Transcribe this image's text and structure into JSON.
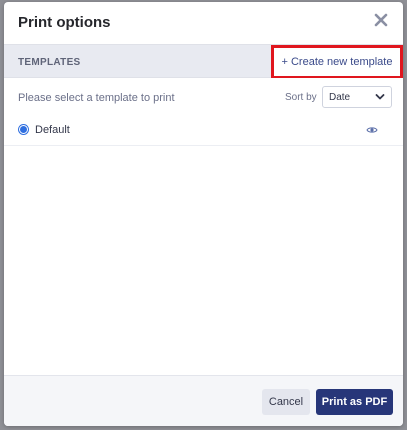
{
  "dialog": {
    "title": "Print options",
    "close_icon": "close-icon"
  },
  "templates_bar": {
    "label": "TEMPLATES",
    "create_link": "+ Create new template",
    "highlight_color": "#e0161e"
  },
  "content": {
    "prompt": "Please select a template to print",
    "sort_label": "Sort by",
    "sort_value": "Date",
    "templates": [
      {
        "name": "Default",
        "selected": true
      }
    ]
  },
  "footer": {
    "cancel_label": "Cancel",
    "print_label": "Print as PDF"
  },
  "colors": {
    "primary": "#273679",
    "radio": "#2f6fe0"
  }
}
